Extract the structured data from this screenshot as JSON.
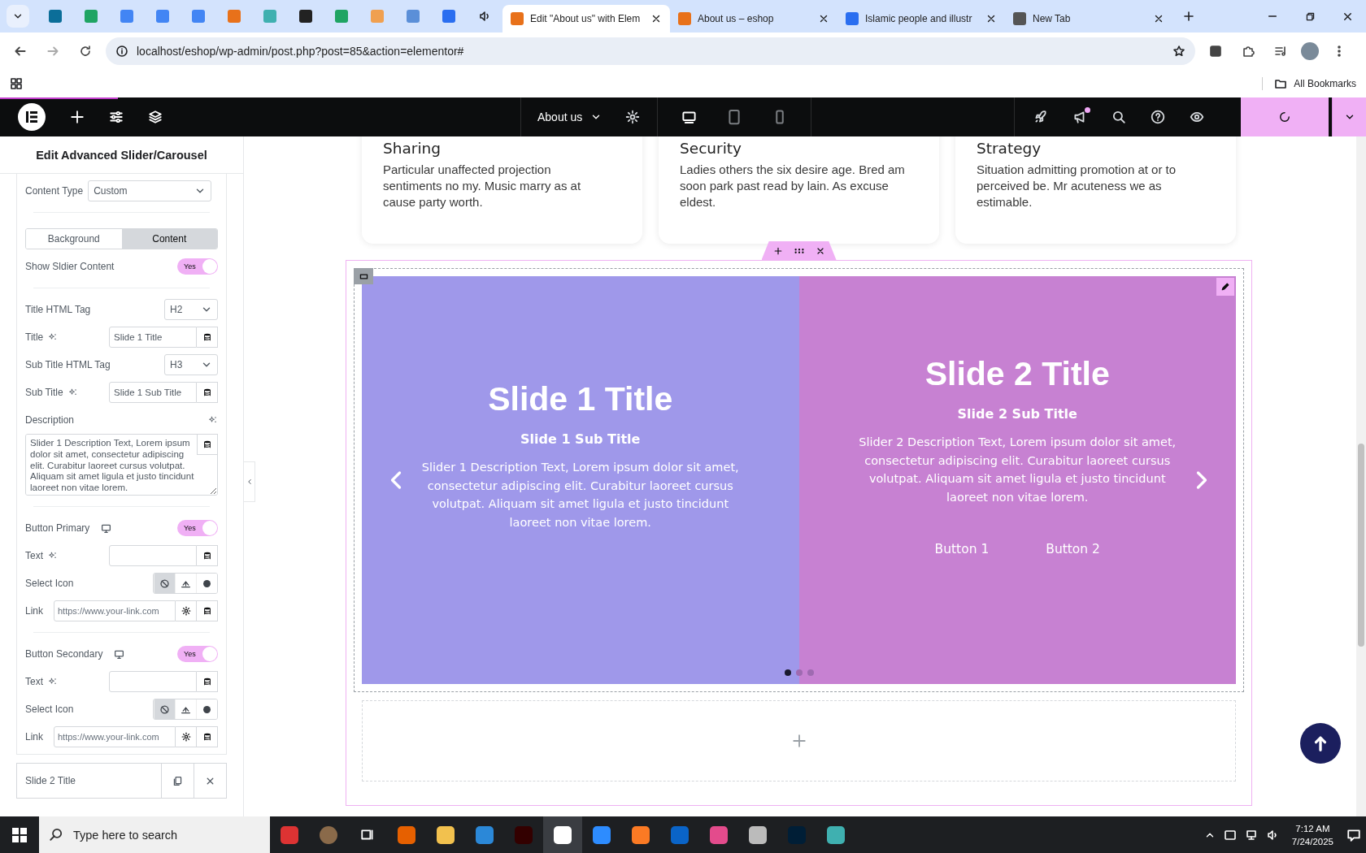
{
  "browser": {
    "tabs": [
      {
        "title": "Edit \"About us\" with Elem",
        "selected": true
      },
      {
        "title": "About us – eshop",
        "selected": false
      },
      {
        "title": "Islamic people and illustr",
        "selected": false
      },
      {
        "title": "New Tab",
        "selected": false
      }
    ],
    "address": "localhost/eshop/wp-admin/post.php?post=85&action=elementor#",
    "bookmarks_label": "All Bookmarks"
  },
  "editor": {
    "page_title": "About us",
    "notification": true,
    "devices": [
      {
        "selected": true
      },
      {
        "selected": false
      },
      {
        "selected": false
      }
    ]
  },
  "panel": {
    "title": "Edit Advanced Slider/Carousel",
    "controls": [
      {
        "kind": "combo",
        "label": "Content Type",
        "value": "Custom"
      },
      {
        "kind": "divider"
      },
      {
        "kind": "segmented",
        "options": [
          {
            "label": "Background",
            "selected": false
          },
          {
            "label": "Content",
            "selected": true
          }
        ]
      },
      {
        "kind": "switch",
        "label": "Show Sldier Content",
        "on": true,
        "state_label": "Yes",
        "responsive": false
      },
      {
        "kind": "divider"
      },
      {
        "kind": "select",
        "label": "Title HTML Tag",
        "value": "H2"
      },
      {
        "kind": "text",
        "label": "Title",
        "ai": true,
        "value": "Slide 1 Title"
      },
      {
        "kind": "select",
        "label": "Sub Title HTML Tag",
        "value": "H3"
      },
      {
        "kind": "text",
        "label": "Sub Title",
        "ai": true,
        "value": "Slide 1 Sub Title"
      },
      {
        "kind": "textarea",
        "label": "Description",
        "ai": true,
        "value": "Slider 1 Description Text, Lorem ipsum dolor sit amet, consectetur adipiscing elit. Curabitur laoreet cursus volutpat. Aliquam sit amet ligula et justo tincidunt laoreet non vitae lorem."
      },
      {
        "kind": "divider"
      },
      {
        "kind": "switch",
        "label": "Button Primary",
        "on": true,
        "state_label": "Yes",
        "responsive": true
      },
      {
        "kind": "text",
        "label": "Text",
        "ai": true
      },
      {
        "kind": "icons",
        "label": "Select Icon",
        "options": [
          {
            "selected": true
          },
          {
            "selected": false
          },
          {
            "selected": false
          }
        ]
      },
      {
        "kind": "link",
        "label": "Link",
        "placeholder": "https://www.your-link.com"
      },
      {
        "kind": "divider"
      },
      {
        "kind": "switch",
        "label": "Button Secondary",
        "on": true,
        "state_label": "Yes",
        "responsive": true
      },
      {
        "kind": "text",
        "label": "Text",
        "ai": true
      },
      {
        "kind": "icons",
        "label": "Select Icon",
        "options": [
          {
            "selected": true
          },
          {
            "selected": false
          },
          {
            "selected": false
          }
        ]
      },
      {
        "kind": "link",
        "label": "Link",
        "placeholder": "https://www.your-link.com"
      }
    ],
    "repeater_items": [
      {
        "title": "Slide 2 Title"
      }
    ]
  },
  "canvas": {
    "cards": [
      {
        "title": "Sharing",
        "text": "Particular unaffected projection sentiments no my. Music marry as at cause party worth."
      },
      {
        "title": "Security",
        "text": "Ladies others the six desire age. Bred am soon park past read by lain. As excuse eldest."
      },
      {
        "title": "Strategy",
        "text": "Situation admitting promotion at or to perceived be. Mr acuteness we as estimable."
      }
    ],
    "slides": [
      {
        "title": "Slide 1 Title",
        "subtitle": "Slide 1 Sub Title",
        "description": "Slider 1 Description Text, Lorem ipsum dolor sit amet, consectetur adipiscing elit. Curabitur laoreet cursus volutpat. Aliquam sit amet ligula et justo tincidunt laoreet non vitae lorem.",
        "color": "#9f98ea"
      },
      {
        "title": "Slide 2 Title",
        "subtitle": "Slide 2 Sub Title",
        "description": "Slider 2 Description Text, Lorem ipsum dolor sit amet, consectetur adipiscing elit. Curabitur laoreet cursus volutpat. Aliquam sit amet ligula et justo tincidunt laoreet non vitae lorem.",
        "color": "#c781d2",
        "buttons": [
          "Button 1",
          "Button 2"
        ]
      }
    ],
    "dots": [
      {
        "selected": true
      },
      {
        "selected": false
      },
      {
        "selected": false
      }
    ]
  },
  "taskbar": {
    "search_placeholder": "Type here to search",
    "apps": [
      {
        "selected": false
      },
      {
        "selected": false
      },
      {
        "selected": false
      },
      {
        "selected": false
      },
      {
        "selected": true
      },
      {
        "selected": false
      },
      {
        "selected": false
      },
      {
        "selected": false
      },
      {
        "selected": false
      },
      {
        "selected": false
      },
      {
        "selected": false
      },
      {
        "selected": false
      }
    ],
    "time": "7:12 AM",
    "date": "7/24/2025"
  }
}
